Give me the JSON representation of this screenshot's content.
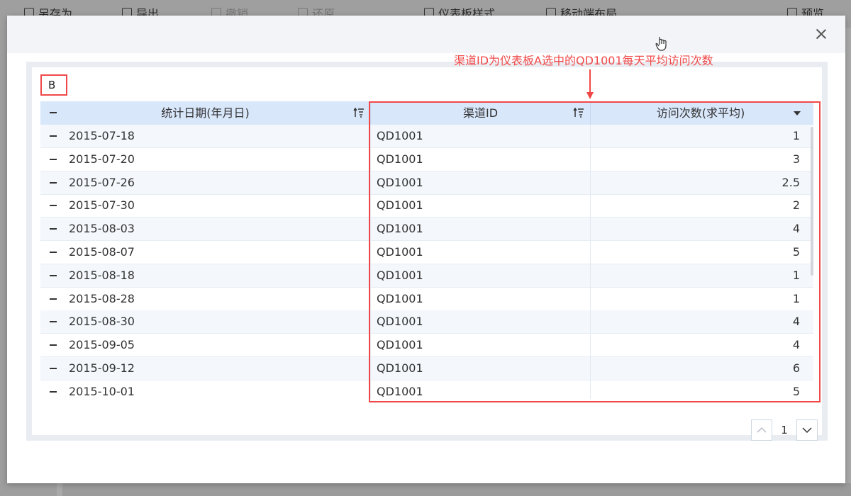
{
  "background_toolbar": {
    "items": [
      {
        "label": "另存为",
        "icon": "save-as-icon"
      },
      {
        "label": "导出",
        "icon": "export-icon"
      },
      {
        "label": "撤销",
        "icon": "undo-icon"
      },
      {
        "label": "还原",
        "icon": "redo-icon"
      },
      {
        "label": "仪表板样式",
        "icon": "dashboard-style-icon"
      },
      {
        "label": "移动端布局",
        "icon": "mobile-layout-icon"
      },
      {
        "label": "预览",
        "icon": "preview-icon"
      }
    ]
  },
  "dialog": {
    "widget_title": "B",
    "annotation": "渠道ID为仪表板A选中的QD1001每天平均访问次数",
    "accent_color": "#f04848",
    "header_color": "#d9e7fb"
  },
  "table": {
    "columns": [
      "统计日期(年月日)",
      "渠道ID",
      "访问次数(求平均)"
    ],
    "rows": [
      {
        "date": "2015-07-18",
        "channel": "QD1001",
        "visits": "1"
      },
      {
        "date": "2015-07-20",
        "channel": "QD1001",
        "visits": "3"
      },
      {
        "date": "2015-07-26",
        "channel": "QD1001",
        "visits": "2.5"
      },
      {
        "date": "2015-07-30",
        "channel": "QD1001",
        "visits": "2"
      },
      {
        "date": "2015-08-03",
        "channel": "QD1001",
        "visits": "4"
      },
      {
        "date": "2015-08-07",
        "channel": "QD1001",
        "visits": "5"
      },
      {
        "date": "2015-08-18",
        "channel": "QD1001",
        "visits": "1"
      },
      {
        "date": "2015-08-28",
        "channel": "QD1001",
        "visits": "1"
      },
      {
        "date": "2015-08-30",
        "channel": "QD1001",
        "visits": "4"
      },
      {
        "date": "2015-09-05",
        "channel": "QD1001",
        "visits": "4"
      },
      {
        "date": "2015-09-12",
        "channel": "QD1001",
        "visits": "6"
      },
      {
        "date": "2015-10-01",
        "channel": "QD1001",
        "visits": "5"
      }
    ]
  },
  "pagination": {
    "page": "1"
  }
}
